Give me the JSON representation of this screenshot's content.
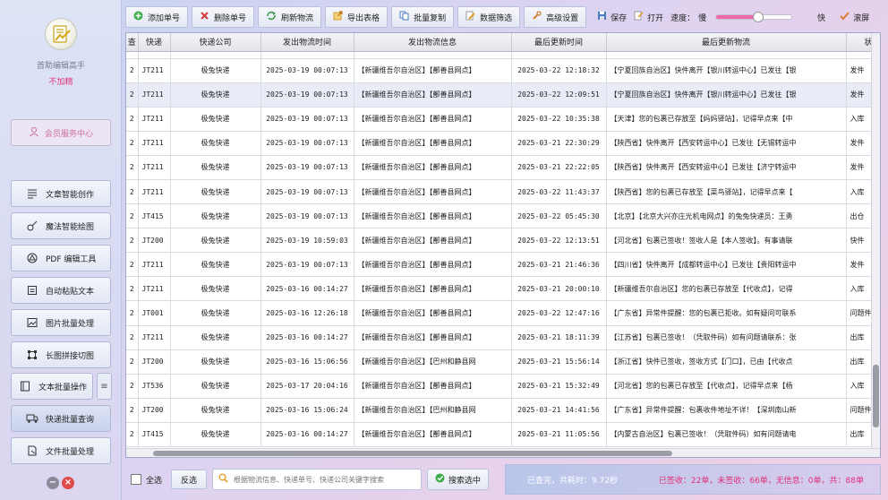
{
  "app": {
    "name": "首助编辑高手",
    "status": "不加精",
    "member_center": "会员服务中心"
  },
  "sidebar": {
    "items": [
      {
        "label": "文章智能创作",
        "icon": "article-icon"
      },
      {
        "label": "魔法智能绘图",
        "icon": "magic-brush-icon"
      },
      {
        "label": "PDF 编辑工具",
        "icon": "pdf-icon"
      },
      {
        "label": "自动粘贴文本",
        "icon": "paste-icon"
      },
      {
        "label": "图片批量处理",
        "icon": "image-icon"
      },
      {
        "label": "长图拼接切图",
        "icon": "crop-icon"
      },
      {
        "label": "文本批量操作",
        "icon": "text-icon"
      },
      {
        "label": "快递批量查询",
        "icon": "truck-icon"
      },
      {
        "label": "文件批量处理",
        "icon": "file-icon"
      }
    ],
    "menu_icon": "hamburger-icon"
  },
  "toolbar": {
    "add": "添加单号",
    "delete": "删除单号",
    "refresh": "刷新物流",
    "export": "导出表格",
    "copy": "批量复制",
    "filter": "数据筛选",
    "advanced": "高级设置",
    "save": "保存",
    "open": "打开",
    "speed_label": "速度：",
    "speed_slow": "慢",
    "speed_fast": "快",
    "speed_level": 0.56,
    "scroll_label": "滚屏"
  },
  "table": {
    "headers": [
      "查",
      "快递",
      "快递公司",
      "发出物流时间",
      "发出物流信息",
      "最后更新时间",
      "最后更新物流",
      "状态"
    ],
    "rows": [
      {
        "n": "2",
        "no": "JT211",
        "company": "极兔快递",
        "sent_time": "2025-03-19 00:07:13",
        "sent_info": "【新疆维吾尔自治区】【鄯善县网点】",
        "last_time": "2025-03-22 12:18:32",
        "last_info": "【宁夏回族自治区】快件离开【银川转运中心】已发往【银",
        "status": "发件"
      },
      {
        "n": "2",
        "no": "JT211",
        "company": "极兔快递",
        "sent_time": "2025-03-19 00:07:13",
        "sent_info": "【新疆维吾尔自治区】【鄯善县网点】",
        "last_time": "2025-03-22 12:09:51",
        "last_info": "【宁夏回族自治区】快件离开【银川转运中心】已发往【银",
        "status": "发件"
      },
      {
        "n": "2",
        "no": "JT211",
        "company": "极兔快递",
        "sent_time": "2025-03-19 00:07:13",
        "sent_info": "【新疆维吾尔自治区】【鄯善县网点】",
        "last_time": "2025-03-22 10:35:38",
        "last_info": "【天津】您的包裹已存放至【妈妈驿站】，记得早点来【中",
        "status": "入库"
      },
      {
        "n": "2",
        "no": "JT211",
        "company": "极兔快递",
        "sent_time": "2025-03-19 00:07:13",
        "sent_info": "【新疆维吾尔自治区】【鄯善县网点】",
        "last_time": "2025-03-21 22:30:29",
        "last_info": "【陕西省】快件离开【西安转运中心】已发往【无锡转运中",
        "status": "发件"
      },
      {
        "n": "2",
        "no": "JT211",
        "company": "极兔快递",
        "sent_time": "2025-03-19 00:07:13",
        "sent_info": "【新疆维吾尔自治区】【鄯善县网点】",
        "last_time": "2025-03-21 22:22:05",
        "last_info": "【陕西省】快件离开【西安转运中心】已发往【济宁转运中",
        "status": "发件"
      },
      {
        "n": "2",
        "no": "JT211",
        "company": "极兔快递",
        "sent_time": "2025-03-19 00:07:13",
        "sent_info": "【新疆维吾尔自治区】【鄯善县网点】",
        "last_time": "2025-03-22 11:43:37",
        "last_info": "【陕西省】您的包裹已存放至【菜鸟驿站】，记得早点来【",
        "status": "入库"
      },
      {
        "n": "2",
        "no": "JT415",
        "company": "极兔快递",
        "sent_time": "2025-03-19 00:07:13",
        "sent_info": "【新疆维吾尔自治区】【鄯善县网点】",
        "last_time": "2025-03-22 05:45:30",
        "last_info": "【北京】【北京大兴亦庄光机电网点】的兔兔快递员：王勇",
        "status": "出仓"
      },
      {
        "n": "2",
        "no": "JT200",
        "company": "极兔快递",
        "sent_time": "2025-03-19 10:59:03",
        "sent_info": "【新疆维吾尔自治区】【鄯善县网点】",
        "last_time": "2025-03-22 12:13:51",
        "last_info": "【河北省】包裹已签收！签收人是【本人签收】。有事请联",
        "status": "快件"
      },
      {
        "n": "2",
        "no": "JT211",
        "company": "极兔快递",
        "sent_time": "2025-03-19 00:07:13",
        "sent_info": "【新疆维吾尔自治区】【鄯善县网点】",
        "last_time": "2025-03-21 21:46:36",
        "last_info": "【四川省】快件离开【成都转运中心】已发往【贵阳转运中",
        "status": "发件"
      },
      {
        "n": "2",
        "no": "JT211",
        "company": "极兔快递",
        "sent_time": "2025-03-16 00:14:27",
        "sent_info": "【新疆维吾尔自治区】【鄯善县网点】",
        "last_time": "2025-03-21 20:00:10",
        "last_info": "【新疆维吾尔自治区】您的包裹已存放至【代收点】，记得",
        "status": "入库"
      },
      {
        "n": "2",
        "no": "JT001",
        "company": "极兔快递",
        "sent_time": "2025-03-16 12:26:18",
        "sent_info": "【新疆维吾尔自治区】【鄯善县网点】",
        "last_time": "2025-03-22 12:47:16",
        "last_info": "【广东省】异常件提醒：您的包裹已拒收。如有疑问可联系",
        "status": "问题件"
      },
      {
        "n": "2",
        "no": "JT211",
        "company": "极兔快递",
        "sent_time": "2025-03-16 00:14:27",
        "sent_info": "【新疆维吾尔自治区】【鄯善县网点】",
        "last_time": "2025-03-21 18:11:39",
        "last_info": "【江苏省】包裹已签收！（凭取件码）如有问题请联系：张",
        "status": "出库"
      },
      {
        "n": "2",
        "no": "JT200",
        "company": "极兔快递",
        "sent_time": "2025-03-16 15:06:56",
        "sent_info": "【新疆维吾尔自治区】【巴州和静县网",
        "last_time": "2025-03-21 15:56:14",
        "last_info": "【浙江省】快件已签收，签收方式【门口】，已由【代收点",
        "status": "出库"
      },
      {
        "n": "2",
        "no": "JT536",
        "company": "极兔快递",
        "sent_time": "2025-03-17 20:04:16",
        "sent_info": "【新疆维吾尔自治区】【鄯善县网点】",
        "last_time": "2025-03-21 15:32:49",
        "last_info": "【河北省】您的包裹已存放至【代收点】，记得早点来【杨",
        "status": "入库"
      },
      {
        "n": "2",
        "no": "JT200",
        "company": "极兔快递",
        "sent_time": "2025-03-16 15:06:24",
        "sent_info": "【新疆维吾尔自治区】【巴州和静县网",
        "last_time": "2025-03-21 14:41:56",
        "last_info": "【广东省】异常件提醒：包裹收件地址不详！【深圳南山新",
        "status": "问题件"
      },
      {
        "n": "2",
        "no": "JT415",
        "company": "极兔快递",
        "sent_time": "2025-03-16 00:14:27",
        "sent_info": "【新疆维吾尔自治区】【鄯善县网点】",
        "last_time": "2025-03-21 11:05:56",
        "last_info": "【内蒙古自治区】包裹已签收！（凭取件码）如有问题请电",
        "status": "出库"
      }
    ]
  },
  "bottom": {
    "select_all": "全选",
    "invert": "反选",
    "search_placeholder": "根据物流信息、快递单号、快递公司关键字搜索",
    "search_button": "搜索选中"
  },
  "status": {
    "done": "已查完，共耗时：9.72秒",
    "counts": "已签收：22单，未签收：66单，无信息：0单，共：88单"
  },
  "colors": {
    "accent_pink": "#e0307a",
    "sidebar_bg": "#dde4f6",
    "status_bg": "#b8c5ea"
  }
}
